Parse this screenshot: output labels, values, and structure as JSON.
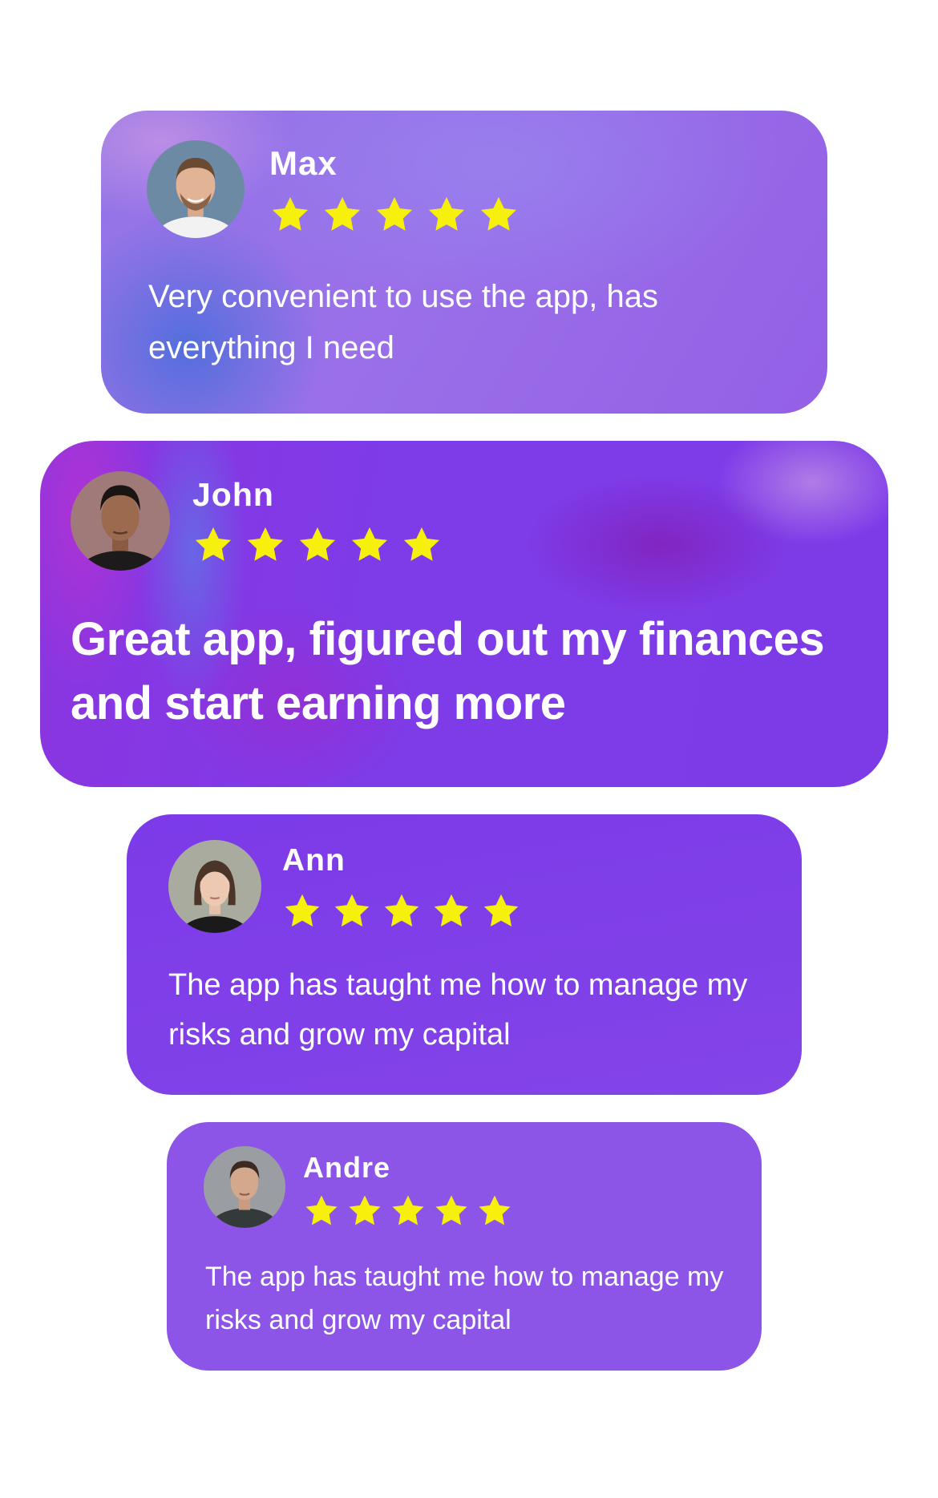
{
  "colors": {
    "star": "#f7f00d",
    "text": "#ffffff",
    "card_purple": "#7d3be8",
    "card_light_purple": "#8d55e7"
  },
  "icons": {
    "rating": "star-icon",
    "avatar": "user-photo"
  },
  "reviews": [
    {
      "name": "Max",
      "rating": 5,
      "text": "Very convenient to use the app, has everything I need"
    },
    {
      "name": "John",
      "rating": 5,
      "text": "Great app, figured out my finances and start earning more"
    },
    {
      "name": "Ann",
      "rating": 5,
      "text": "The app has taught me how to manage  my risks and grow my capital"
    },
    {
      "name": "Andre",
      "rating": 5,
      "text": "The app has taught me how to manage  my risks and grow my capital"
    }
  ]
}
